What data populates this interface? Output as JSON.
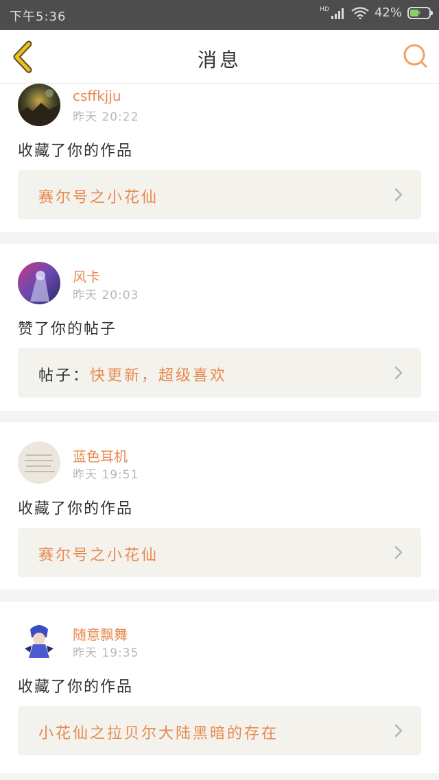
{
  "status_bar": {
    "time": "下午5:36",
    "network_label": "HD",
    "battery_percent": "42%"
  },
  "header": {
    "title": "消息"
  },
  "colors": {
    "accent": "#e8894e",
    "back_arrow": "#f0c020",
    "search_ring": "#f0a060"
  },
  "messages": [
    {
      "username": "csffkjju",
      "time": "昨天 20:22",
      "action": "收藏了你的作品",
      "link_prefix": "",
      "link_text": "赛尔号之小花仙"
    },
    {
      "username": "风卡",
      "time": "昨天 20:03",
      "action": "赞了你的帖子",
      "link_prefix": "帖子：",
      "link_text": "快更新，超级喜欢"
    },
    {
      "username": "蓝色耳机",
      "time": "昨天 19:51",
      "action": "收藏了你的作品",
      "link_prefix": "",
      "link_text": "赛尔号之小花仙"
    },
    {
      "username": "随意飘舞",
      "time": "昨天 19:35",
      "action": "收藏了你的作品",
      "link_prefix": "",
      "link_text": "小花仙之拉贝尔大陆黑暗的存在"
    }
  ],
  "icons": {
    "back": "chevron-left-icon",
    "search": "search-icon",
    "link_arrow": "chevron-right-icon"
  }
}
